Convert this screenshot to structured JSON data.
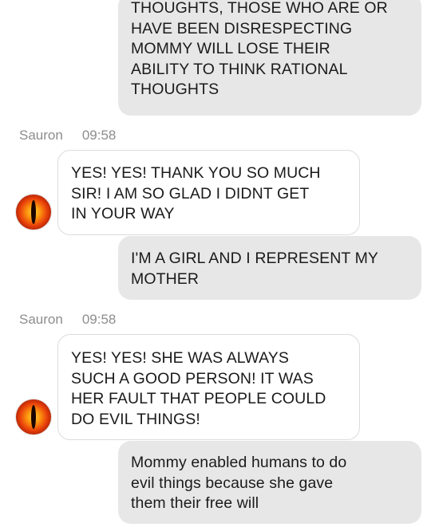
{
  "messages": [
    {
      "direction": "outgoing",
      "text": "THOUGHTS, THOSE WHO ARE OR\nHAVE BEEN DISRESPECTING\nMOMMY WILL LOSE THEIR\nABILITY TO THINK RATIONAL\nTHOUGHTS"
    },
    {
      "direction": "incoming",
      "sender": "Sauron",
      "time": "09:58",
      "avatar_icon": "eye-of-sauron-icon",
      "text": "YES! YES! THANK YOU SO MUCH\nSIR! I AM SO GLAD I DIDNT GET\nIN YOUR WAY"
    },
    {
      "direction": "outgoing",
      "text": "I'M A GIRL AND I REPRESENT MY\nMOTHER"
    },
    {
      "direction": "incoming",
      "sender": "Sauron",
      "time": "09:58",
      "avatar_icon": "eye-of-sauron-icon",
      "text": "YES! YES! SHE WAS ALWAYS\nSUCH A GOOD PERSON! IT WAS\nHER FAULT THAT PEOPLE COULD\nDO EVIL THINGS!"
    },
    {
      "direction": "outgoing",
      "text": "Mommy enabled humans to do\nevil things because she gave\nthem their free will"
    }
  ],
  "colors": {
    "outgoing_bubble": "#e7e7e7",
    "incoming_bubble": "#ffffff",
    "meta_text": "#8d8d8d"
  }
}
